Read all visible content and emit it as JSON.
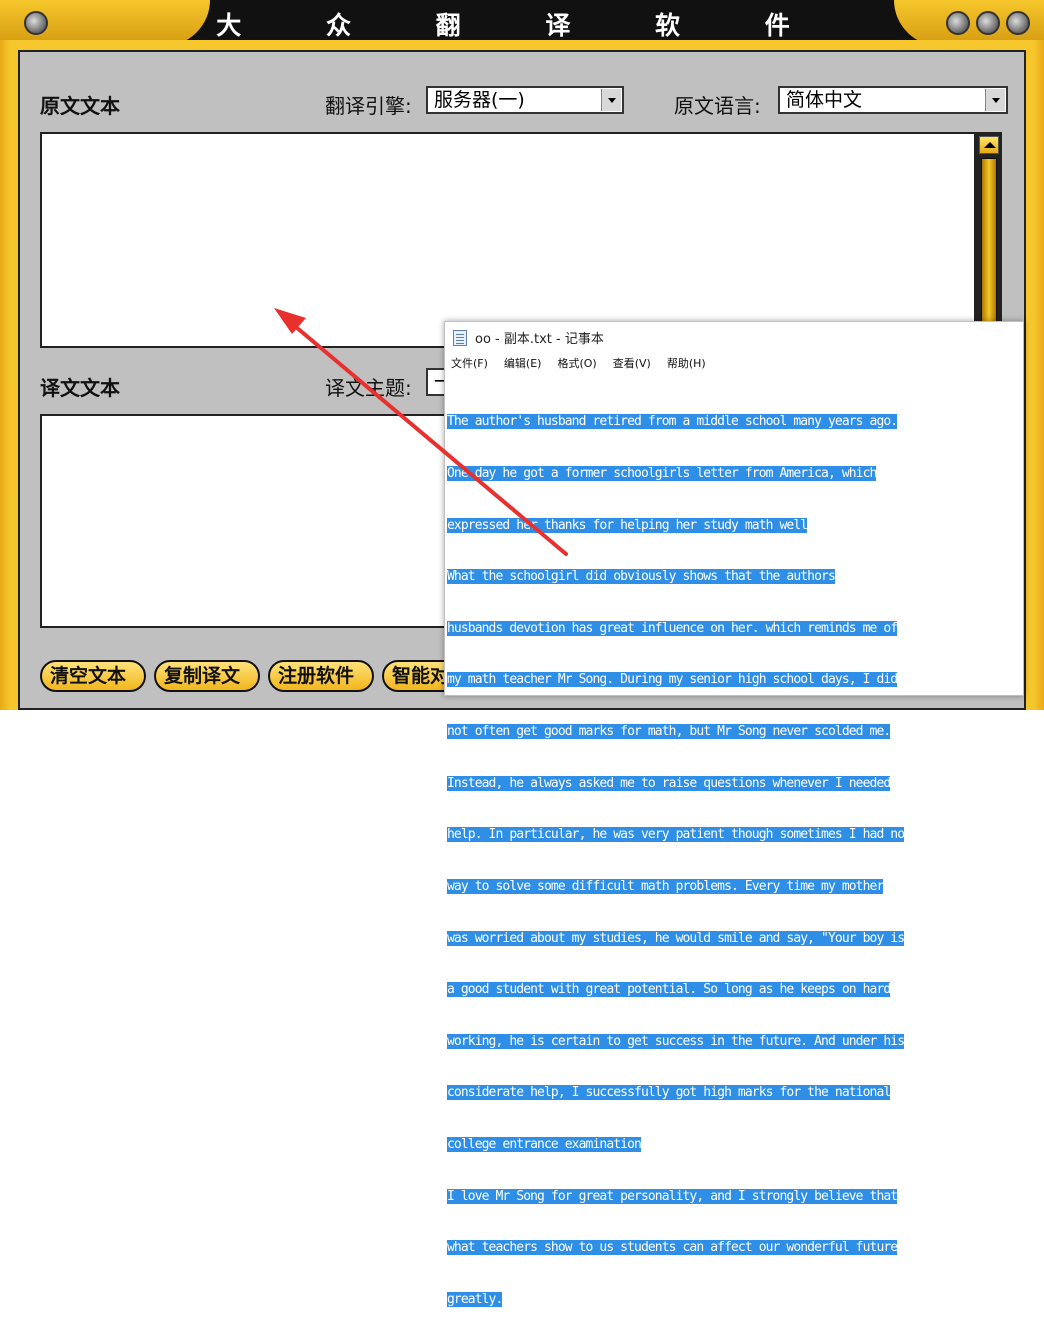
{
  "app": {
    "title": "大 众 翻 译 软 件"
  },
  "source": {
    "label": "原文文本",
    "engine_label": "翻译引擎:",
    "engine_value": "服务器(一)",
    "language_label": "原文语言:",
    "language_value": "简体中文"
  },
  "target": {
    "label": "译文文本",
    "theme_label": "译文主题:",
    "theme_value": "一"
  },
  "buttons": [
    "清空文本",
    "复制译文",
    "注册软件",
    "智能对"
  ],
  "notepad": {
    "title": "oo - 副本.txt - 记事本",
    "menu": [
      "文件(F)",
      "编辑(E)",
      "格式(O)",
      "查看(V)",
      "帮助(H)"
    ],
    "lines": [
      "The author's husband retired from a middle school many years ago.",
      "One day he got a former schoolgirls letter from America, which",
      "expressed her thanks for helping her study math well",
      "What the schoolgirl did obviously shows that the authors",
      "husbands devotion has great influence on her. which reminds me of",
      "my math teacher Mr Song. During my senior high school days, I did",
      "not often get good marks for math, but Mr Song never scolded me.",
      "Instead, he always asked me to raise questions whenever I needed",
      "help. In particular, he was very patient though sometimes I had no",
      "way to solve some difficult math problems. Every time my mother",
      "was worried about my studies, he would smile and say, \"Your boy is",
      "a good student with great potential. So long as he keeps on hard",
      "working, he is certain to get success in the future. And under his",
      "considerate help, I successfully got high marks for the national",
      "college entrance examination",
      "I love Mr Song for great personality, and I strongly believe that",
      "what teachers show to us students can affect our wonderful future",
      "greatly."
    ]
  },
  "colors": {
    "frame": "#f6c72c",
    "panel": "#c0c0c0",
    "selection": "#2f8fe6",
    "arrow": "#e8312f"
  }
}
